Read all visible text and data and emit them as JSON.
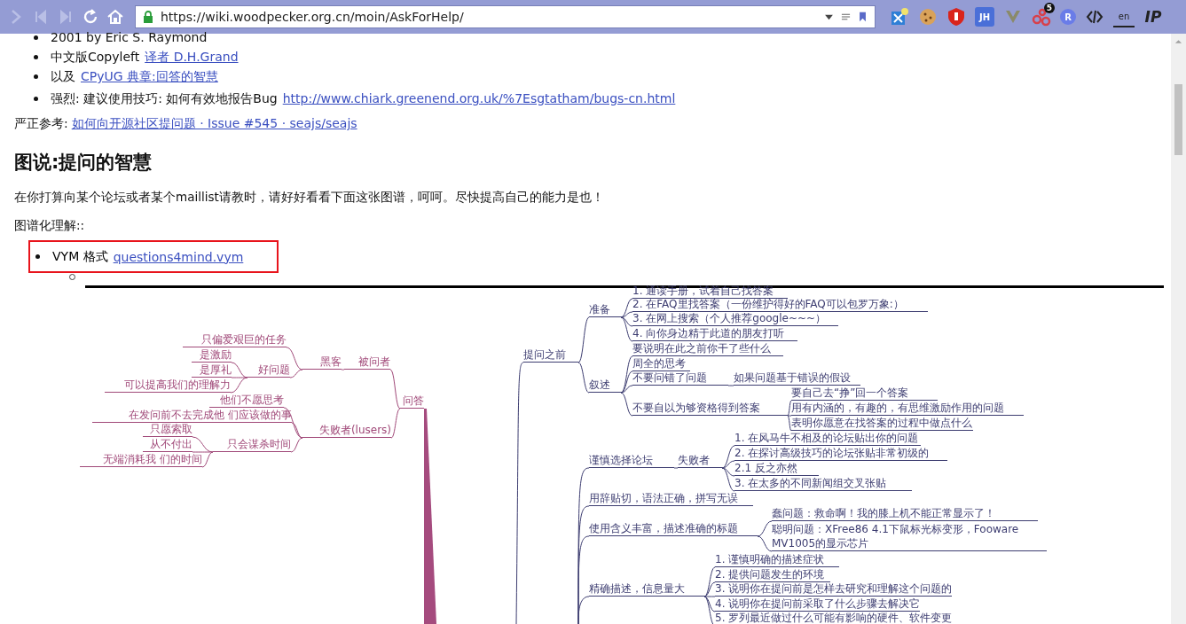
{
  "browser": {
    "nav_buttons": [
      {
        "kind": "forward",
        "disabled": true
      },
      {
        "kind": "first",
        "disabled": true
      },
      {
        "kind": "last",
        "disabled": true
      },
      {
        "kind": "reload",
        "disabled": false
      },
      {
        "kind": "home",
        "disabled": false
      }
    ],
    "url": "https://wiki.woodpecker.org.cn/moin/AskForHelp/",
    "extensions": [
      {
        "kind": "puzzle"
      },
      {
        "kind": "cookie"
      },
      {
        "kind": "shield"
      },
      {
        "kind": "text",
        "label": "JH"
      },
      {
        "kind": "v"
      },
      {
        "kind": "badge",
        "label": "5"
      },
      {
        "kind": "round",
        "label": "R"
      },
      {
        "kind": "code"
      },
      {
        "kind": "translate",
        "label": "en"
      },
      {
        "kind": "logo",
        "label": "IP"
      }
    ]
  },
  "credits": [
    {
      "text": "2001 by Eric S. Raymond"
    },
    {
      "text": "中文版Copyleft",
      "link": "译者 D.H.Grand"
    },
    {
      "text": "以及",
      "link": "CPyUG 典章:回答的智慧"
    },
    {
      "text": "强烈: 建议使用技巧: 如何有效地报告Bug",
      "link": "http://www.chiark.greenend.org.uk/%7Esgtatham/bugs-cn.html"
    }
  ],
  "reference": {
    "text": "严正参考:",
    "link": "如何向开源社区提问题 · Issue #545 · seajs/seajs"
  },
  "heading": "图说:提问的智慧",
  "intro": "在你打算向某个论坛或者某个maillist请教时，请好好看看下面这张图谱，呵呵。尽快提高自己的能力是也！",
  "map_label": "图谱化理解::",
  "format_item": {
    "text": "VYM 格式",
    "link": "questions4mind.vym",
    "highlighted": true
  },
  "mind_map": {
    "left": {
      "text": "问答",
      "children": [
        {
          "text": "被问者",
          "children": [
            {
              "text": "黑客",
              "children": [
                {
                  "text": "只偏爱艰巨的任务"
                },
                {
                  "text": "好问题",
                  "children": [
                    {
                      "text": "是激励"
                    },
                    {
                      "text": "是厚礼"
                    },
                    {
                      "text": "可以提高我们的理解力"
                    }
                  ]
                }
              ]
            }
          ]
        },
        {
          "text": "失败者(lusers)",
          "children": [
            {
              "text": "他们不愿思考"
            },
            {
              "text": "在发问前不去完成他 们应该做的事"
            },
            {
              "text": "只会谋杀时间",
              "children": [
                {
                  "text": "只愿索取"
                },
                {
                  "text": "从不付出"
                },
                {
                  "text": "无端消耗我 们的时间"
                }
              ]
            }
          ]
        }
      ]
    },
    "right": {
      "text": "提问之前",
      "children": [
        {
          "text": "准备",
          "children": [
            {
              "text": "1. 通读手册，试着自己找答案"
            },
            {
              "text": "2. 在FAQ里找答案（一份维护得好的FAQ可以包罗万象:）"
            },
            {
              "text": "3. 在网上搜索（个人推荐google~~~）"
            },
            {
              "text": "4. 向你身边精于此道的朋友打听"
            }
          ]
        },
        {
          "text": "叙述",
          "children": [
            {
              "text": "要说明在此之前你干了些什么"
            },
            {
              "text": "周全的思考"
            },
            {
              "text": "不要问错了问题",
              "children": [
                {
                  "text": "如果问题基于错误的假设"
                }
              ]
            },
            {
              "text": "不要自以为够资格得到答案",
              "children": [
                {
                  "text": "要自己去“挣”回一个答案"
                },
                {
                  "text": "用有内涵的，有趣的，有思维激励作用的问题"
                },
                {
                  "text": "表明你愿意在找答案的过程中做点什么"
                }
              ]
            }
          ]
        }
      ]
    },
    "right_lower": [
      {
        "text": "谨慎选择论坛",
        "children": [
          {
            "text": "失败者",
            "children": [
              {
                "text": "1. 在风马牛不相及的论坛贴出你的问题"
              },
              {
                "text": "2. 在探讨高级技巧的论坛张贴非常初级的"
              },
              {
                "text": "2.1 反之亦然"
              },
              {
                "text": "3. 在太多的不同新闻组交叉张贴"
              }
            ]
          }
        ]
      },
      {
        "text": "用辞贴切，语法正确，拼写无误"
      },
      {
        "text": "使用含义丰富，描述准确的标题",
        "children": [
          {
            "text": "蠢问题：救命啊！我的膝上机不能正常显示了！"
          },
          {
            "text": "聪明问题：XFree86 4.1下鼠标光标变形，Fooware MV1005的显示芯片"
          }
        ]
      },
      {
        "text": "精确描述，信息量大",
        "children": [
          {
            "text": "1. 谨慎明确的描述症状"
          },
          {
            "text": "2. 提供问题发生的环境"
          },
          {
            "text": "3. 说明你在提问前是怎样去研究和理解这个问题的"
          },
          {
            "text": "4. 说明你在提问前采取了什么步骤去解决它"
          },
          {
            "text": "5. 罗列最近做过什么可能有影响的硬件、软件变更"
          }
        ]
      }
    ]
  }
}
